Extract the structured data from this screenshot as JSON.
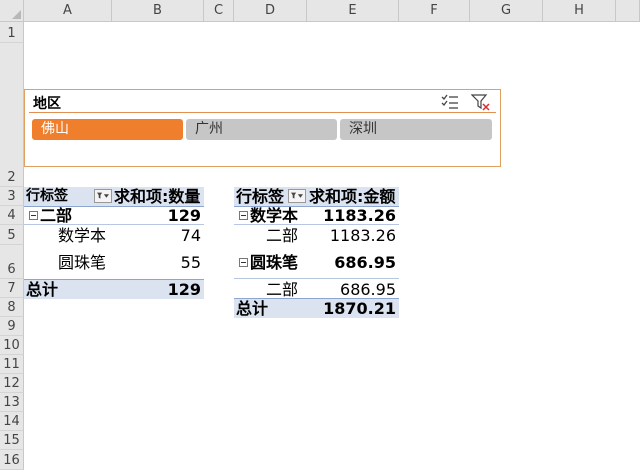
{
  "columns": [
    "A",
    "B",
    "C",
    "D",
    "E",
    "F",
    "G",
    "H"
  ],
  "rows": [
    "1",
    "2",
    "3",
    "4",
    "5",
    "6",
    "7",
    "8",
    "9",
    "10",
    "11",
    "12",
    "13",
    "14",
    "15",
    "16"
  ],
  "slicer": {
    "title": "地区",
    "multiselect_icon": "multi-select-icon",
    "clear_filter_icon": "clear-filter-icon",
    "items": [
      {
        "label": "佛山",
        "selected": true
      },
      {
        "label": "广州",
        "selected": false
      },
      {
        "label": "深圳",
        "selected": false
      }
    ],
    "colors": {
      "selected": "#ef7f2c",
      "unselected": "#c6c6c6",
      "border": "#e0a060"
    }
  },
  "pivot1": {
    "row_label": "行标签",
    "value_label": "求和项:数量",
    "group": {
      "label": "二部",
      "value": "129"
    },
    "items": [
      {
        "label": "数学本",
        "value": "74"
      },
      {
        "label": "圆珠笔",
        "value": "55"
      }
    ],
    "total": {
      "label": "总计",
      "value": "129"
    }
  },
  "pivot2": {
    "row_label": "行标签",
    "value_label": "求和项:金额",
    "groups": [
      {
        "label": "数学本",
        "value": "1183.26",
        "child": {
          "label": "二部",
          "value": "1183.26"
        }
      },
      {
        "label": "圆珠笔",
        "value": "686.95",
        "child": {
          "label": "二部",
          "value": "686.95"
        }
      }
    ],
    "total": {
      "label": "总计",
      "value": "1870.21"
    }
  }
}
